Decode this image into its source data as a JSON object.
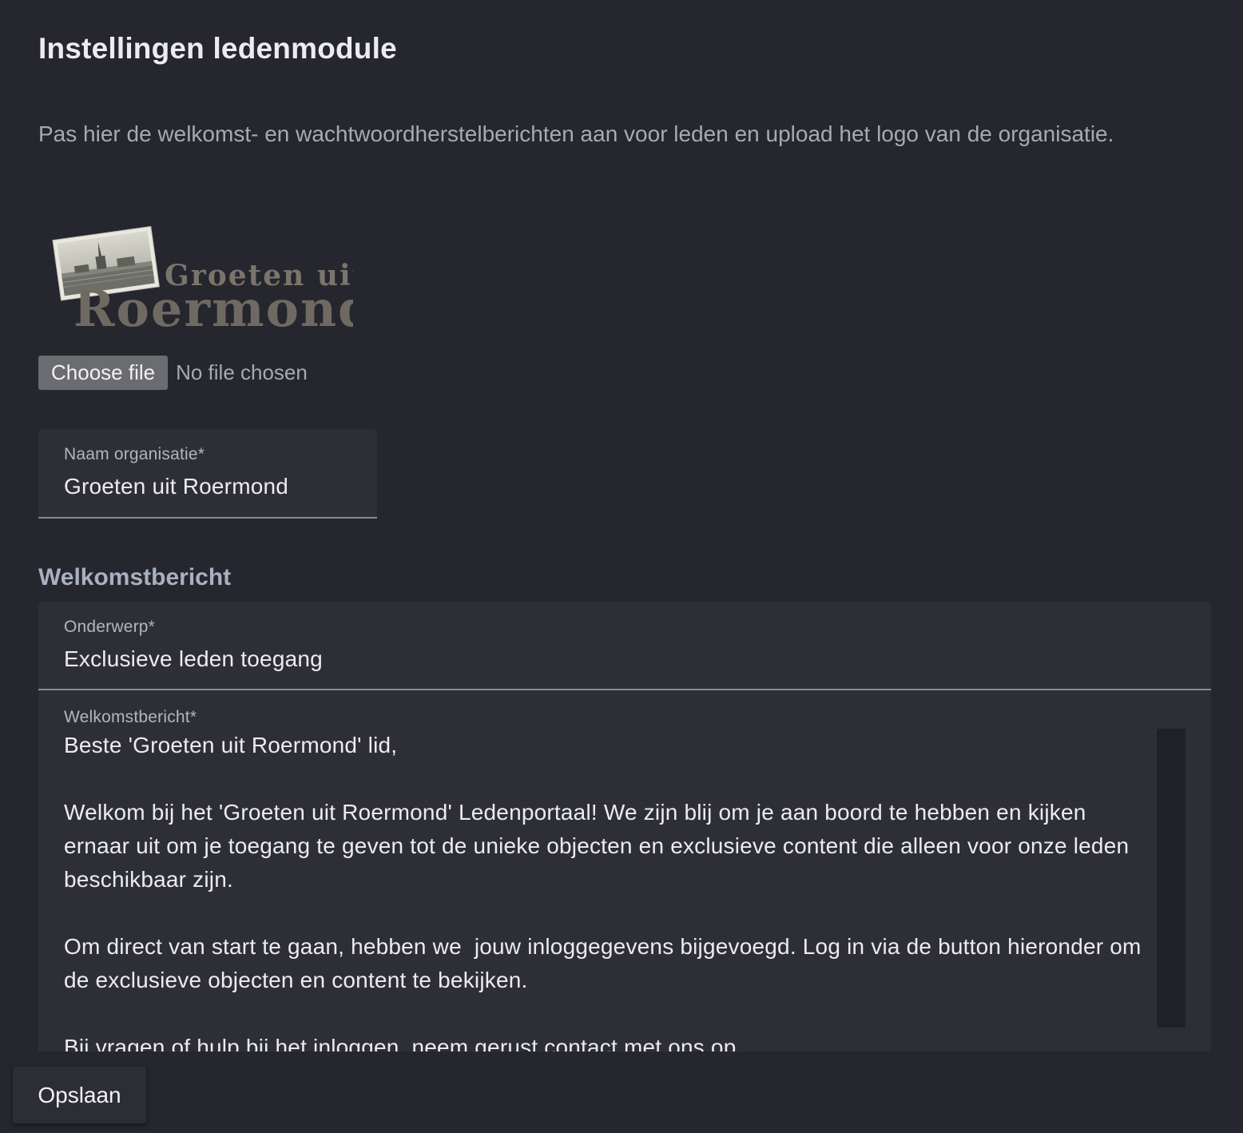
{
  "page": {
    "title": "Instellingen ledenmodule",
    "description": "Pas hier de welkomst- en wachtwoordherstelberichten aan voor leden en upload het logo van de organisatie."
  },
  "logo": {
    "line1": "Groeten uit",
    "line2": "Roermond"
  },
  "upload": {
    "button_label": "Choose file",
    "status": "No file chosen"
  },
  "organisation": {
    "label": "Naam organisatie*",
    "value": "Groeten uit Roermond"
  },
  "welcome": {
    "section_title": "Welkomstbericht",
    "subject_label": "Onderwerp*",
    "subject_value": "Exclusieve leden toegang",
    "message_label": "Welkomstbericht*",
    "message_value": "Beste 'Groeten uit Roermond' lid,\n\nWelkom bij het 'Groeten uit Roermond' Ledenportaal! We zijn blij om je aan boord te hebben en kijken ernaar uit om je toegang te geven tot de unieke objecten en exclusieve content die alleen voor onze leden beschikbaar zijn.\n\nOm direct van start te gaan, hebben we  jouw inloggegevens bijgevoegd. Log in via de button hieronder om de exclusieve objecten en content te bekijken.\n\nBij vragen of hulp bij het inloggen, neem gerust contact met ons op."
  },
  "actions": {
    "save_label": "Opslaan"
  }
}
